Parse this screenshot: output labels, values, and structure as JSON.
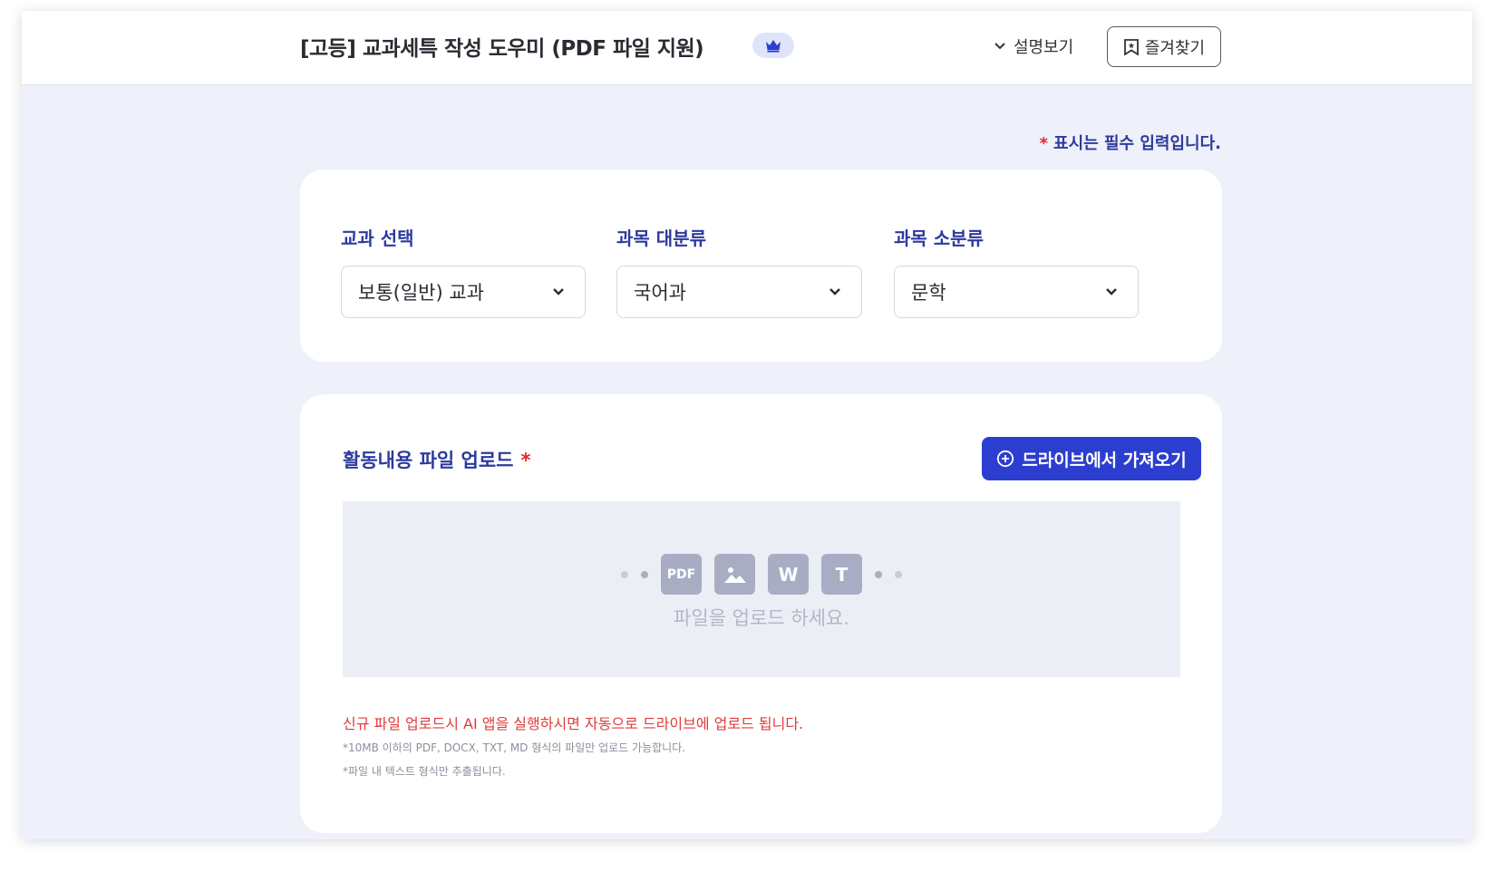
{
  "header": {
    "title": "[고등] 교과세특 작성 도우미 (PDF 파일 지원)",
    "premium_icon": "crown-icon",
    "desc_toggle_label": "설명보기",
    "bookmark_label": "즐겨찾기"
  },
  "required_note": {
    "star": "*",
    "text": "표시는 필수 입력입니다."
  },
  "selectors": {
    "subject_type": {
      "label": "교과 선택",
      "value": "보통(일반) 교과"
    },
    "category_major": {
      "label": "과목 대분류",
      "value": "국어과"
    },
    "category_minor": {
      "label": "과목 소분류",
      "value": "문학"
    }
  },
  "upload": {
    "title": "활동내용 파일 업로드",
    "required_star": "*",
    "drive_button_label": "드라이브에서 가져오기",
    "file_type_icons": [
      "PDF",
      "image",
      "W",
      "T"
    ],
    "drop_text": "파일을 업로드 하세요.",
    "notice": "신규 파일 업로드시 AI 앱을 실행하시면 자동으로 드라이브에 업로드 됩니다.",
    "help_lines": [
      "*10MB 이하의 PDF, DOCX, TXT, MD 형식의 파일만 업로드 가능합니다.",
      "*파일 내 텍스트 형식만 추출됩니다."
    ]
  },
  "colors": {
    "accent": "#2c3ed0",
    "label_blue": "#2d3a9e",
    "required_red": "#e0282e",
    "background": "#eef0fa"
  }
}
